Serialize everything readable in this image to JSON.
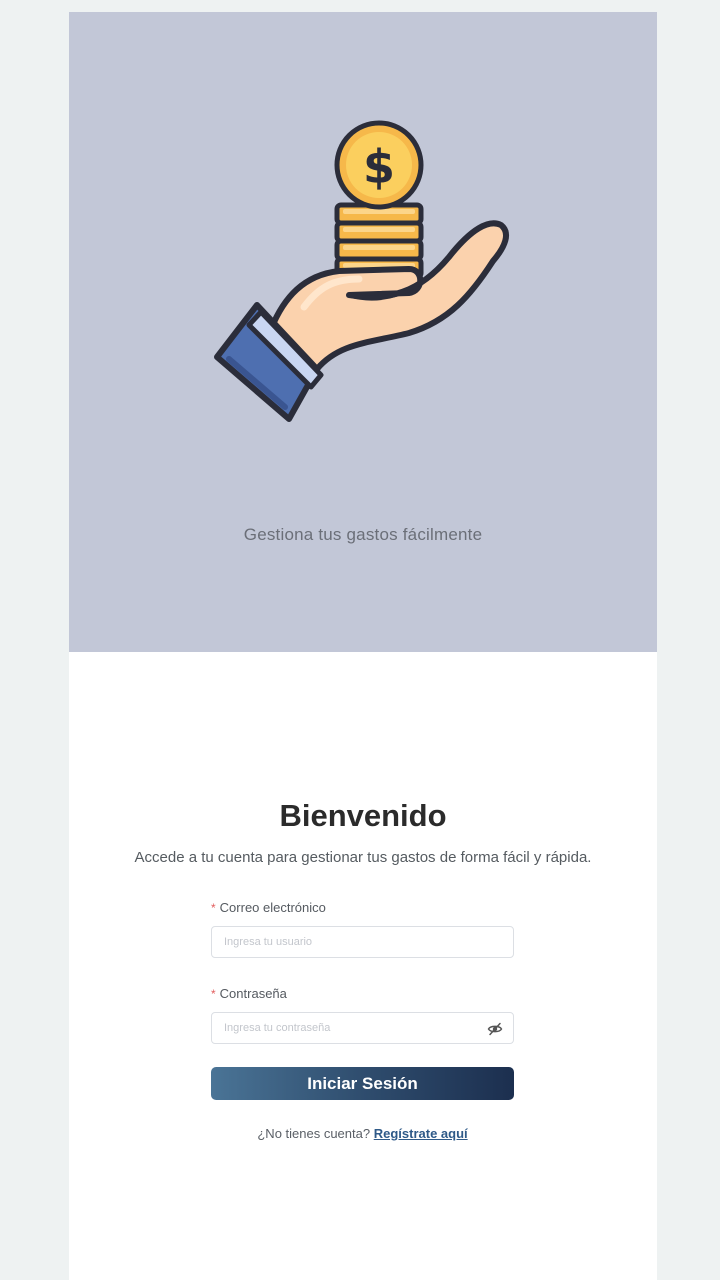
{
  "hero": {
    "tagline": "Gestiona tus gastos fácilmente",
    "illustration_icon": "hand-holding-coins-icon"
  },
  "login": {
    "title": "Bienvenido",
    "subtitle": "Accede a tu cuenta para gestionar tus gastos de forma fácil y rápida.",
    "required_mark": "*",
    "email_label": "Correo electrónico",
    "email_placeholder": "Ingresa tu usuario",
    "email_value": "",
    "password_label": "Contraseña",
    "password_placeholder": "Ingresa tu contraseña",
    "password_value": "",
    "password_toggle_icon": "eye-slash-icon",
    "submit_label": "Iniciar Sesión",
    "register_prompt": "¿No tienes cuenta?",
    "register_link": "Regístrate aquí"
  },
  "colors": {
    "hero_background": "#c2c7d7",
    "button_gradient_start": "#4a7496",
    "button_gradient_end": "#1c2f4f",
    "link": "#2f5a88",
    "required": "#e25d5d"
  }
}
